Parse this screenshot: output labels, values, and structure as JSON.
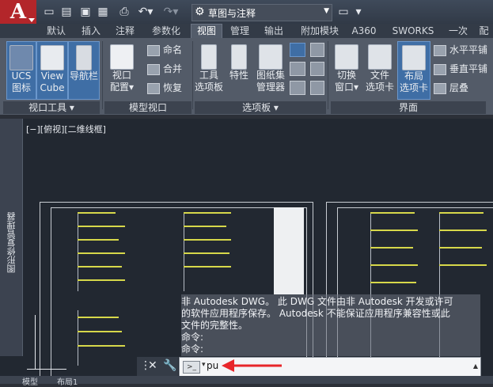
{
  "title_bar": {
    "logo_letter": "A",
    "workspace": "草图与注释"
  },
  "tabs": [
    "默认",
    "插入",
    "注释",
    "参数化",
    "视图",
    "管理",
    "输出",
    "附加模块",
    "A360",
    "SWORKS",
    "一次",
    "配"
  ],
  "active_tab": "视图",
  "ribbon": {
    "view_tools": {
      "buttons": [
        {
          "label1": "UCS",
          "label2": "图标"
        },
        {
          "label1": "View",
          "label2": "Cube"
        },
        {
          "label1": "导航栏",
          "label2": ""
        }
      ],
      "panel_label": "视口工具"
    },
    "model_viewports": {
      "big": {
        "label1": "视口",
        "label2": "配置"
      },
      "small": [
        "命名",
        "合并",
        "恢复"
      ],
      "panel_label": "模型视口"
    },
    "palettes": {
      "buttons": [
        {
          "label1": "工具",
          "label2": "选项板"
        },
        {
          "label1": "特性",
          "label2": ""
        },
        {
          "label1": "图纸集",
          "label2": "管理器"
        }
      ],
      "panel_label": "选项板"
    },
    "interface": {
      "buttons": [
        {
          "label1": "切换",
          "label2": "窗口"
        },
        {
          "label1": "文件",
          "label2": "选项卡"
        },
        {
          "label1": "布局",
          "label2": "选项卡"
        }
      ],
      "small": [
        "水平平铺",
        "垂直平铺",
        "层叠"
      ],
      "panel_label": "界面"
    }
  },
  "viewport_label": "[−][俯视][二维线框]",
  "side_palette": "图形修复管理器",
  "command_history": [
    "非 Autodesk DWG。 此 DWG 文件由非 Autodesk 开发或许可",
    "的软件应用程序保存。 Autodesk 不能保证应用程序兼容性或此",
    "文件的完整性。",
    "命令:",
    "命令:"
  ],
  "command_input": "pu",
  "status_tabs": [
    "模型",
    "布局1"
  ],
  "colors": {
    "accent": "#3f6ea5",
    "logo": "#b3262a",
    "annotation_arrow": "#e8262a"
  }
}
